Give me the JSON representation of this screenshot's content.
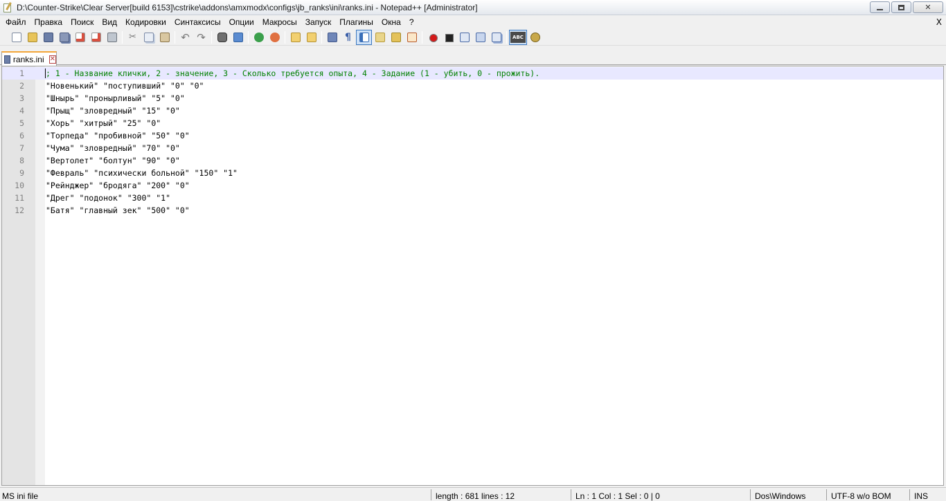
{
  "window": {
    "title": "D:\\Counter-Strike\\Clear Server[build 6153]\\cstrike\\addons\\amxmodx\\configs\\jb_ranks\\ini\\ranks.ini - Notepad++ [Administrator]",
    "close_menu_label": "X"
  },
  "menu": {
    "items": [
      "Файл",
      "Правка",
      "Поиск",
      "Вид",
      "Кодировки",
      "Синтаксисы",
      "Опции",
      "Макросы",
      "Запуск",
      "Плагины",
      "Окна",
      "?"
    ]
  },
  "toolbar": {
    "icons": [
      "new-file-icon",
      "open-file-icon",
      "save-icon",
      "save-all-icon",
      "close-icon",
      "close-all-icon",
      "print-icon",
      "cut-icon",
      "copy-icon",
      "paste-icon",
      "undo-icon",
      "redo-icon",
      "find-icon",
      "replace-icon",
      "zoom-in-icon",
      "zoom-out-icon",
      "sync-v-icon",
      "sync-h-icon",
      "word-wrap-icon",
      "show-all-chars-icon",
      "indent-guide-icon",
      "fold-all-icon",
      "document-map-icon",
      "function-list-icon",
      "record-macro-icon",
      "stop-record-icon",
      "play-macro-icon",
      "play-macro-multiple-icon",
      "save-macro-icon",
      "spell-check-icon",
      "spell-check-settings-icon"
    ]
  },
  "tabs": [
    {
      "label": "ranks.ini",
      "active": true
    }
  ],
  "editor": {
    "lines": [
      {
        "num": "1",
        "text": "; 1 - Название клички, 2 - значение, 3 - Сколько требуется опыта, 4 - Задание (1 - убить, 0 - прожить).",
        "style": "comment"
      },
      {
        "num": "2",
        "text": "\"Новенький\" \"поступивший\" \"0\" \"0\"",
        "style": "normal"
      },
      {
        "num": "3",
        "text": "\"Шнырь\" \"пронырливый\" \"5\" \"0\"",
        "style": "normal"
      },
      {
        "num": "4",
        "text": "\"Прыщ\" \"зловредный\" \"15\" \"0\"",
        "style": "normal"
      },
      {
        "num": "5",
        "text": "\"Хорь\" \"хитрый\" \"25\" \"0\"",
        "style": "normal"
      },
      {
        "num": "6",
        "text": "\"Торпеда\" \"пробивной\" \"50\" \"0\"",
        "style": "normal"
      },
      {
        "num": "7",
        "text": "\"Чума\" \"зловредный\" \"70\" \"0\"",
        "style": "normal"
      },
      {
        "num": "8",
        "text": "\"Вертолет\" \"болтун\" \"90\" \"0\"",
        "style": "normal"
      },
      {
        "num": "9",
        "text": "\"Февраль\" \"психически больной\" \"150\" \"1\"",
        "style": "normal"
      },
      {
        "num": "10",
        "text": "\"Рейнджер\" \"бродяга\" \"200\" \"0\"",
        "style": "normal"
      },
      {
        "num": "11",
        "text": "\"Дрег\" \"подонок\" \"300\" \"1\"",
        "style": "normal"
      },
      {
        "num": "12",
        "text": "\"Батя\" \"главный зек\" \"500\" \"0\"",
        "style": "normal"
      }
    ]
  },
  "statusbar": {
    "file_type": "MS ini file",
    "length_lines": "length : 681    lines : 12",
    "position": "Ln : 1    Col : 1    Sel : 0 | 0",
    "eol": "Dos\\Windows",
    "encoding": "UTF-8 w/o BOM",
    "mode": "INS"
  },
  "colors": {
    "comment": "#008000",
    "current_line": "#e8e8ff",
    "gutter": "#e4e4e4",
    "tab_accent": "#f3a63a"
  }
}
